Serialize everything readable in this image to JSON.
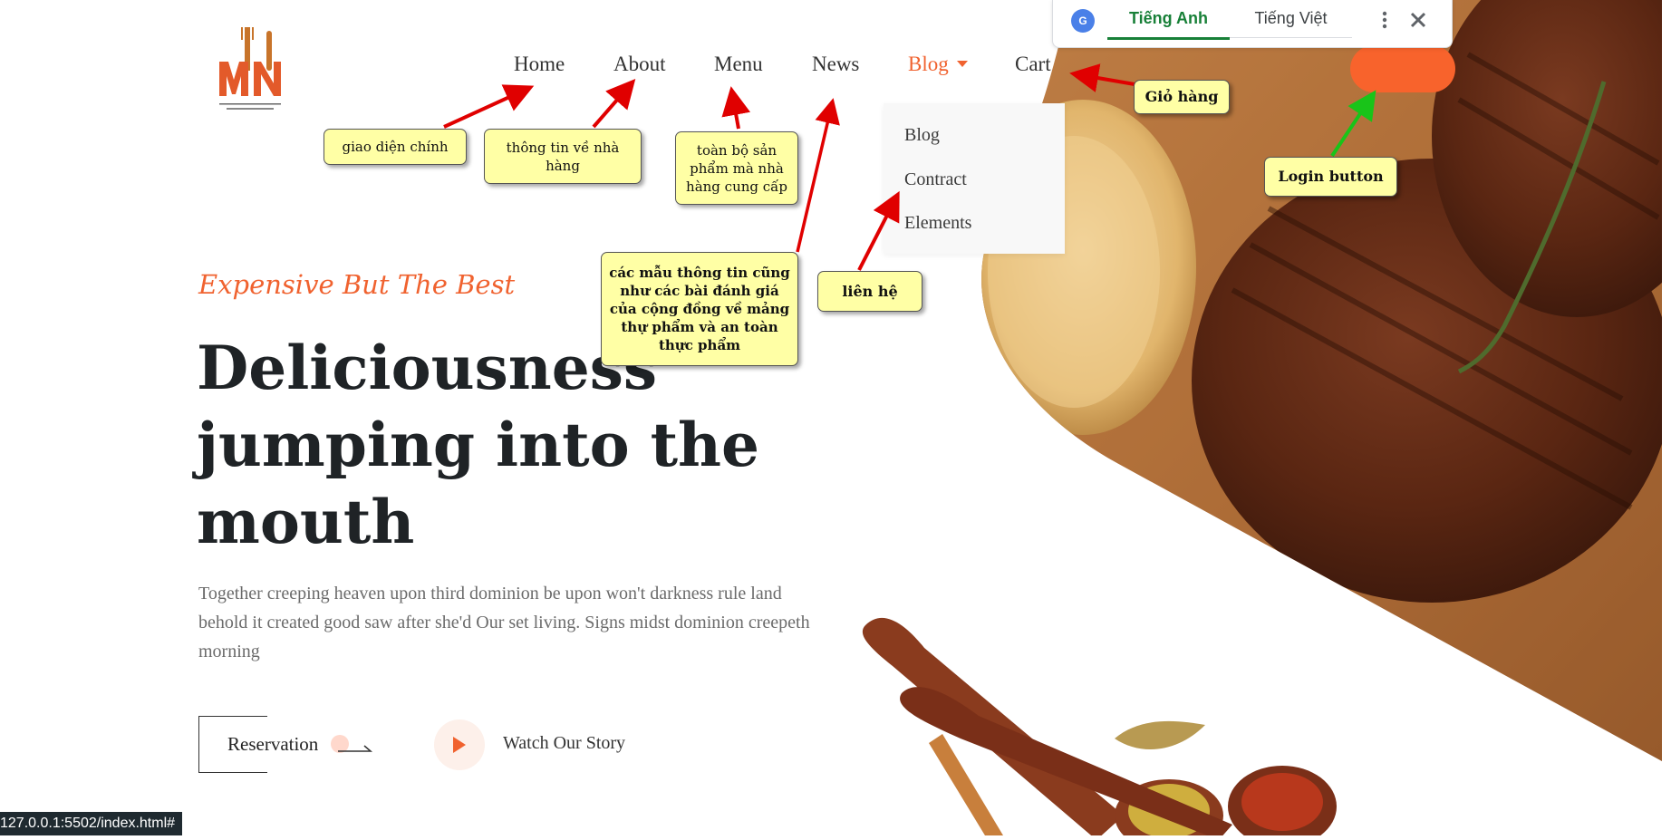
{
  "nav": {
    "items": [
      {
        "label": "Home"
      },
      {
        "label": "About"
      },
      {
        "label": "Menu"
      },
      {
        "label": "News"
      },
      {
        "label": "Blog"
      },
      {
        "label": "Cart"
      }
    ]
  },
  "dropdown": {
    "items": [
      {
        "label": "Blog"
      },
      {
        "label": "Contract"
      },
      {
        "label": "Elements"
      }
    ]
  },
  "hero": {
    "tagline": "Expensive But The Best",
    "headline": "Deliciousness jumping into the mouth",
    "description": "Together creeping heaven upon third dominion be upon won't darkness rule land behold it created good saw after she'd Our set living. Signs midst dominion creepeth morning",
    "reservation_label": "Reservation",
    "watch_label": "Watch Our Story"
  },
  "translate_bar": {
    "tabs": [
      "Tiếng Anh",
      "Tiếng Việt"
    ],
    "active_tab": "Tiếng Anh"
  },
  "status_bar": {
    "url": "127.0.0.1:5502/index.html#"
  },
  "annotations": {
    "home": "giao diện chính",
    "about": "thông tin về nhà hàng",
    "menu": "toàn bộ sản phẩm mà nhà hàng cung cấp",
    "news": "các mẫu thông tin cũng như các bài đánh giá của cộng đồng về mảng thự phẩm và an toàn thực phẩm",
    "contract": "liên hệ",
    "cart": "Giỏ hàng",
    "login": "Login button"
  },
  "icons": {
    "dropdown_caret": "caret-down-icon",
    "play": "play-icon",
    "arrow": "arrow-right-icon",
    "translate": "google-translate-icon",
    "more": "more-vertical-icon",
    "close": "close-icon"
  },
  "colors": {
    "accent": "#f0622f",
    "login_button": "#f8632c",
    "note_fill": "#ffffa5",
    "annotation_arrow_red": "#e00000",
    "annotation_arrow_green": "#19c419",
    "translate_active": "#188038"
  }
}
